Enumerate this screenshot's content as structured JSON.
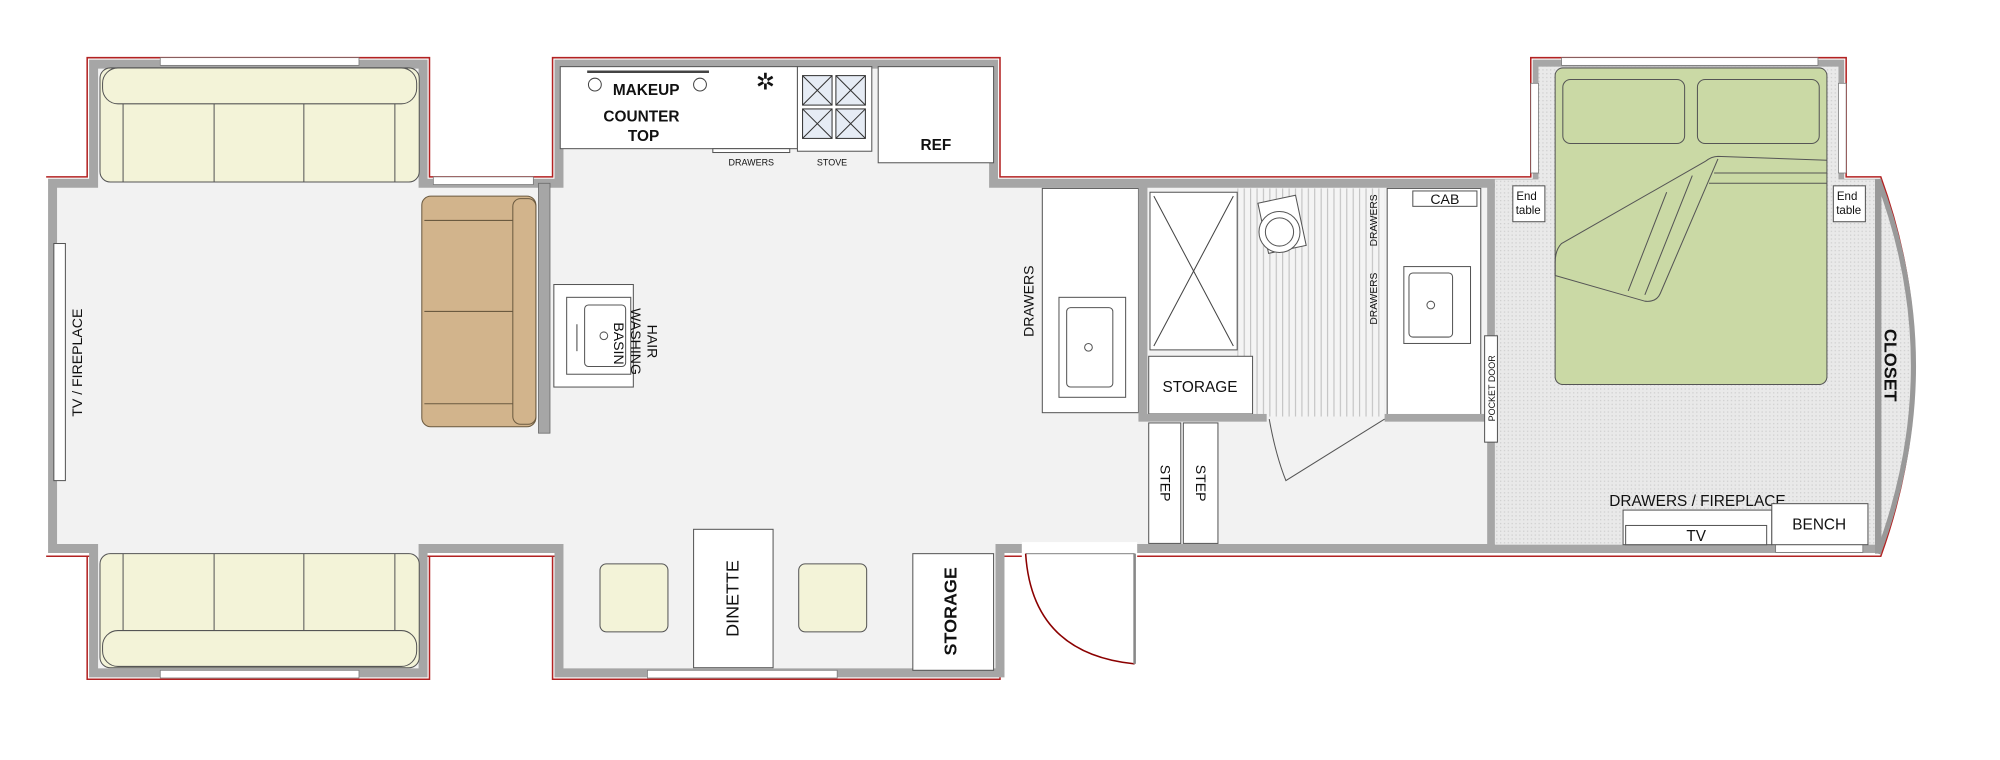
{
  "colors": {
    "floor": "#f2f2f2",
    "wall": "#a6a6a6",
    "exterior_line": "#b22222",
    "sofa": "#f3f3d8",
    "brown_sofa": "#d2b48c",
    "bed": "#cad9a5",
    "burner": "#e6ecf5"
  },
  "living": {
    "tv_label": "TV / FIREPLACE",
    "basin_line1": "HAIR",
    "basin_line2": "WASHING",
    "basin_line3": "BASIN"
  },
  "kitchen": {
    "makeup_label": "MAKEUP",
    "counter_line1": "COUNTER",
    "counter_line2": "TOP",
    "drawers_label": "DRAWERS",
    "stove_label": "STOVE",
    "ref_label": "REF"
  },
  "dining": {
    "dinette_label": "DINETTE",
    "storage_label": "STORAGE"
  },
  "bath": {
    "vanity_drawers_label": "DRAWERS",
    "storage_label": "STORAGE",
    "drawers_upper_label": "DRAWERS",
    "drawers_lower_label": "DRAWERS",
    "cab_label": "CAB",
    "pocket_door_label": "POCKET DOOR",
    "step1_label": "STEP",
    "step2_label": "STEP"
  },
  "bedroom": {
    "end_table_left": [
      "End",
      "table"
    ],
    "end_table_right": [
      "End",
      "table"
    ],
    "closet_label": "CLOSET",
    "drawers_fireplace_label": "DRAWERS / FIREPLACE",
    "tv_label": "TV",
    "bench_label": "BENCH"
  }
}
